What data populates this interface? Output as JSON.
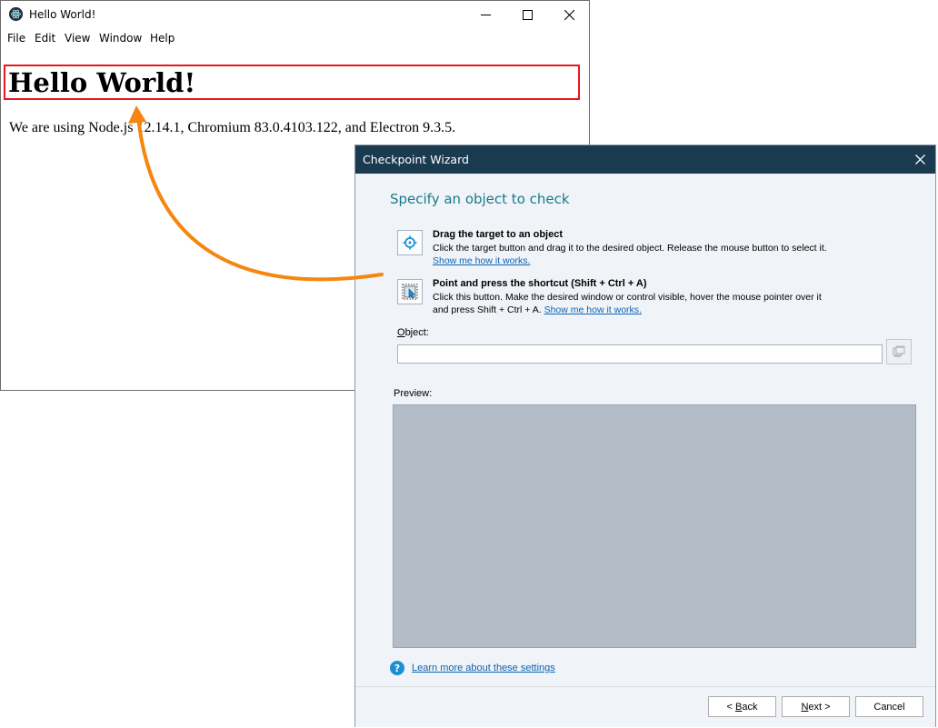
{
  "hello_window": {
    "title": "Hello World!",
    "menu": [
      "File",
      "Edit",
      "View",
      "Window",
      "Help"
    ],
    "heading": "Hello World!",
    "paragraph": "We are using Node.js 12.14.1, Chromium 83.0.4103.122, and Electron 9.3.5.",
    "highlight_color": "#e8171d"
  },
  "annotation": {
    "arrow_color": "#f5860f"
  },
  "wizard": {
    "title": "Checkpoint Wizard",
    "heading": "Specify an object to check",
    "option_drag": {
      "title": "Drag the target to an object",
      "description": "Click the target button and drag it to the desired object. Release the mouse button to select it.",
      "link": "Show me how it works."
    },
    "option_shortcut": {
      "title": "Point and press the shortcut (Shift + Ctrl + A)",
      "description_line1": "Click this button. Make the desired window or control visible, hover the mouse pointer over it",
      "description_line2": "and press Shift + Ctrl + A.",
      "link": "Show me how it works."
    },
    "object_label_accel": "O",
    "object_label_rest": "bject:",
    "object_value": "",
    "preview_label": "Preview:",
    "help_link": "Learn more about these settings",
    "buttons": {
      "back_prefix": "< ",
      "back_accel": "B",
      "back_rest": "ack",
      "next_accel": "N",
      "next_rest": "ext >",
      "cancel": "Cancel"
    },
    "colors": {
      "titlebar": "#1a3a4f",
      "heading": "#1a7a8c",
      "link": "#0b64b8",
      "preview": "#b4bcc8"
    }
  }
}
